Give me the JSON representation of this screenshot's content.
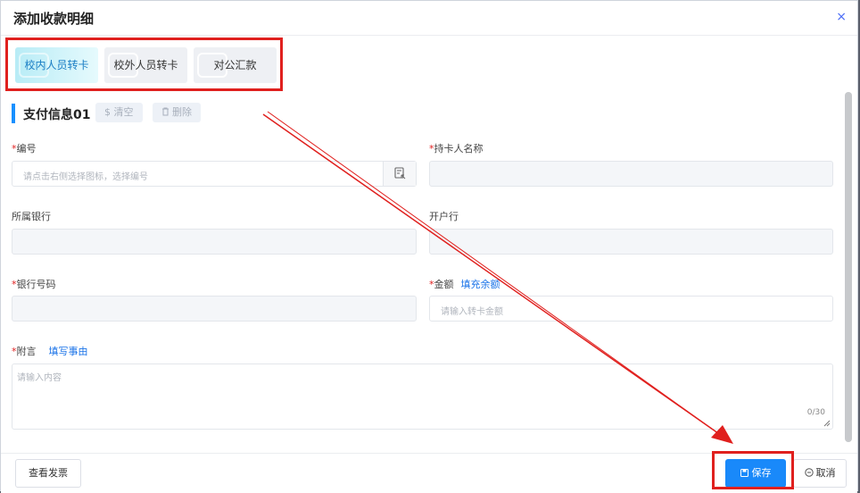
{
  "dialog": {
    "title": "添加收款明细",
    "close_glyph": "×"
  },
  "tabs": [
    {
      "label": "校内人员转卡",
      "active": true
    },
    {
      "label": "校外人员转卡",
      "active": false
    },
    {
      "label": "对公汇款",
      "active": false
    }
  ],
  "section": {
    "title": "支付信息01",
    "clear_label": "$ 清空",
    "delete_label": "删除"
  },
  "fields": {
    "number": {
      "label": "编号",
      "required": "*",
      "placeholder": "请点击右侧选择图标，选择编号"
    },
    "cardholder": {
      "label": "持卡人名称",
      "required": "*"
    },
    "bank": {
      "label": "所属银行"
    },
    "branch": {
      "label": "开户行"
    },
    "account": {
      "label": "银行号码",
      "required": "*"
    },
    "amount": {
      "label": "金额",
      "required": "*",
      "link": "填充余额",
      "placeholder": "请输入转卡金额"
    },
    "note": {
      "label": "附言",
      "required": "*",
      "link": "填写事由",
      "placeholder": "请输入内容",
      "counter": "0/30"
    }
  },
  "footer": {
    "invoice_label": "查看发票",
    "save_label": "保存",
    "cancel_label": "取消"
  },
  "colors": {
    "primary": "#1989fa",
    "annotation": "#e0201e",
    "link": "#1a73e8"
  }
}
